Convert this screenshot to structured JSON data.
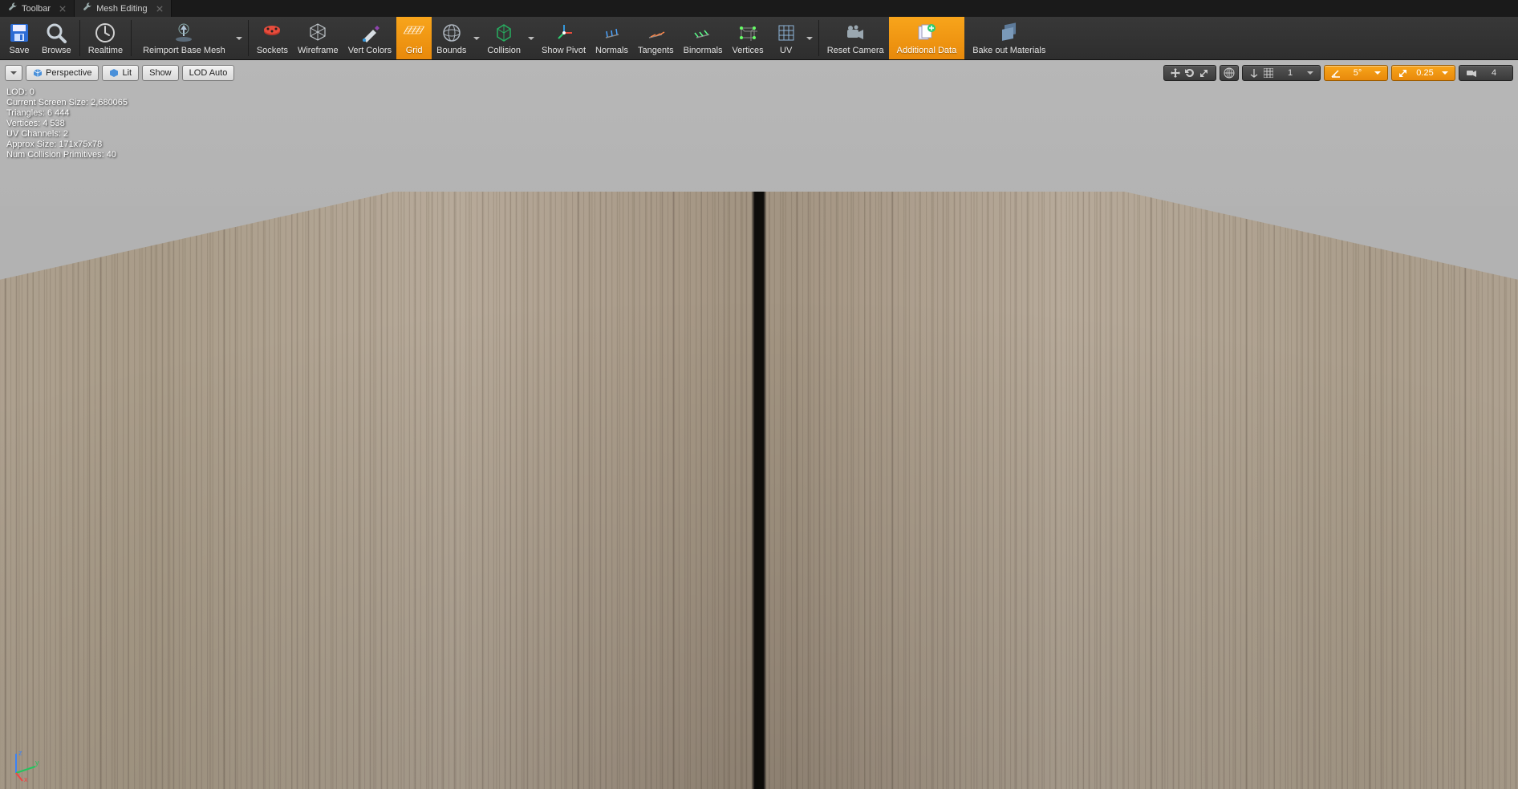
{
  "tabs": [
    {
      "label": "Toolbar"
    },
    {
      "label": "Mesh Editing"
    }
  ],
  "toolbar": {
    "save": "Save",
    "browse": "Browse",
    "realtime": "Realtime",
    "reimport": "Reimport Base Mesh",
    "sockets": "Sockets",
    "wireframe": "Wireframe",
    "vertcolors": "Vert Colors",
    "grid": "Grid",
    "bounds": "Bounds",
    "collision": "Collision",
    "showpivot": "Show Pivot",
    "normals": "Normals",
    "tangents": "Tangents",
    "binormals": "Binormals",
    "vertices": "Vertices",
    "uv": "UV",
    "resetcamera": "Reset Camera",
    "additionaldata": "Additional Data",
    "bakematerials": "Bake out Materials"
  },
  "viewport_controls": {
    "menu": "",
    "perspective": "Perspective",
    "lit": "Lit",
    "show": "Show",
    "lod_auto": "LOD Auto",
    "transform_space": "1",
    "angle_snap": "5°",
    "scale_snap": "0.25",
    "cam_speed": "4"
  },
  "stats": {
    "lod": "LOD:  0",
    "screensize": "Current Screen Size:  2,680065",
    "triangles": "Triangles:  6 444",
    "vertices": "Vertices:  4 538",
    "uvchannels": "UV Channels:  2",
    "approxsize": "Approx Size:  171x75x78",
    "collision": "Num Collision Primitives:  40"
  },
  "gizmo": {
    "x": "x",
    "y": "y",
    "z": "z"
  }
}
